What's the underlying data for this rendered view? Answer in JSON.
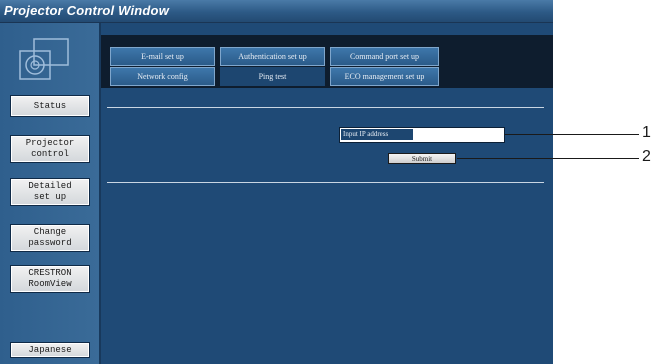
{
  "window": {
    "title": "Projector Control Window"
  },
  "sidebar": {
    "items": [
      {
        "label": "Status"
      },
      {
        "label": "Projector\ncontrol"
      },
      {
        "label": "Detailed\nset up"
      },
      {
        "label": "Change\npassword"
      },
      {
        "label": "CRESTRON\nRoomView"
      },
      {
        "label": "Japanese"
      }
    ]
  },
  "tabs": {
    "row1": [
      {
        "label": "E-mail set up"
      },
      {
        "label": "Authentication set up"
      },
      {
        "label": "Command port set up"
      }
    ],
    "row2": [
      {
        "label": "Network config"
      },
      {
        "label": "Ping test"
      },
      {
        "label": "ECO management set up"
      }
    ]
  },
  "ping": {
    "ip_label": "Input IP address",
    "ip_value": "",
    "submit_label": "Submit"
  },
  "callouts": [
    "1",
    "2"
  ]
}
